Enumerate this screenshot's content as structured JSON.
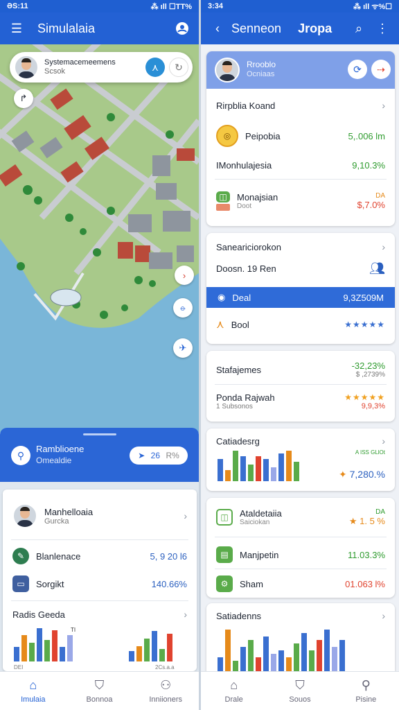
{
  "left": {
    "status_time": "ƏS:11",
    "status_icons": "⁂ ıll ☐TT%",
    "title": "Simulalaia",
    "search": {
      "name": "Systemacemeemens",
      "sub": "Scsok"
    },
    "sheet": {
      "title": "Ramblioene",
      "sub": "Omealdie",
      "pill_value": "26",
      "pill_unit": "R%"
    },
    "profile": {
      "name": "Manhelloaia",
      "sub": "Gurcka"
    },
    "rows": [
      {
        "label": "Blanlenace",
        "value": "5, 9 20 l6"
      },
      {
        "label": "Sorgikt",
        "value": "140.66%"
      }
    ],
    "chart": {
      "title": "Radis Geeda",
      "tag1": "TI",
      "foot1": "DEI",
      "foot2": "2Cs.a.a",
      "values_a": [
        30,
        55,
        40,
        70,
        45,
        65,
        30,
        55
      ],
      "values_b": [
        20,
        30,
        45,
        60,
        25,
        55
      ]
    },
    "nav": [
      {
        "label": "Imulaia",
        "icon": "home-icon"
      },
      {
        "label": "Bonnoa",
        "icon": "shield-icon"
      },
      {
        "label": "Inniioners",
        "icon": "users-icon"
      }
    ]
  },
  "right": {
    "status_time": "3:34",
    "status_icons": "⁂ ıll ᯤ%☐",
    "title_a": "Senneon",
    "title_b": "Jropa",
    "profile": {
      "name": "Rrooblo",
      "sub": "Ocniaas"
    },
    "card1": {
      "header": "Rirpblia Koand",
      "rows": [
        {
          "label": "Peipobia",
          "value": "5,.006 lm"
        },
        {
          "label": "IMonhulajesia",
          "value": "9,10.3%"
        },
        {
          "label": "Monajsian",
          "sub": "Doot",
          "value_top": "DA",
          "value": "$,7.0%"
        }
      ]
    },
    "card2": {
      "header": "Saneariciorokon",
      "row": "Doosn. 19  Ren",
      "blue_label": "Deal",
      "blue_value": "9,3Z509M",
      "row2": "Bool"
    },
    "card3": {
      "header": "Stafajemes",
      "header_value": "-32,23%",
      "header_sub": "$ ,2739%",
      "row": "Ponda Rajwah",
      "row_sub": "1 Subsonos",
      "row_value": "9,9,3%"
    },
    "card4": {
      "header": "Catiadesrg",
      "value_top": "A ISS GLlOt",
      "value": "7,280.%",
      "bars": [
        40,
        20,
        55,
        45,
        30,
        45,
        40,
        25,
        50,
        55,
        35
      ]
    },
    "card5": {
      "rows": [
        {
          "label": "Ataldetaiia",
          "sub": "Saiciokan",
          "value_top": "DA",
          "value": "1. 5 %"
        },
        {
          "label": "Manjpetin",
          "value": "11.03.3%"
        },
        {
          "label": "Sham",
          "value": "01.063 l%"
        }
      ]
    },
    "card6": {
      "header": "Satiadenns",
      "bars": [
        20,
        60,
        15,
        35,
        45,
        20,
        50,
        25,
        30,
        20,
        40,
        55,
        30,
        45,
        60,
        35,
        45
      ]
    },
    "nav": [
      {
        "label": "Drale",
        "icon": "home-icon"
      },
      {
        "label": "Souos",
        "icon": "bag-icon"
      },
      {
        "label": "Pisine",
        "icon": "user-icon"
      }
    ]
  }
}
